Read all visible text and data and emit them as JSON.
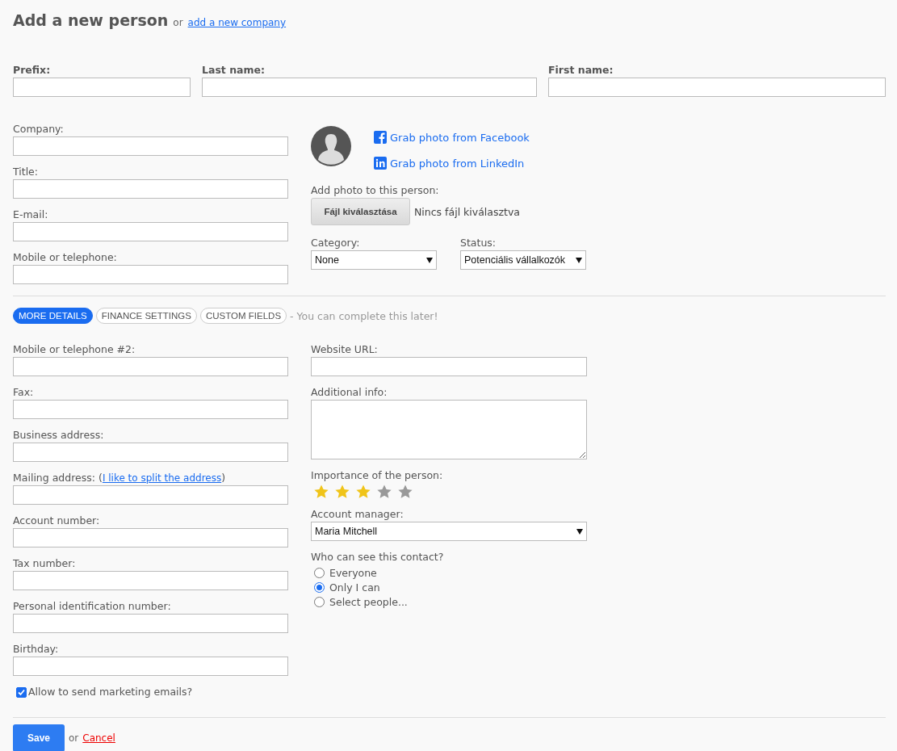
{
  "header": {
    "title": "Add a new person",
    "or_text": "or",
    "company_link": "add a new company"
  },
  "name_fields": [
    {
      "label": "Prefix:"
    },
    {
      "label": "Last name:"
    },
    {
      "label": "First name:"
    }
  ],
  "contact_fields": [
    {
      "label": "Company:"
    },
    {
      "label": "Title:"
    },
    {
      "label": "E-mail:"
    },
    {
      "label": "Mobile or telephone:"
    }
  ],
  "photo": {
    "facebook_link": "Grab photo from Facebook",
    "linkedin_link": "Grab photo from LinkedIn",
    "add_label": "Add photo to this person:",
    "file_button": "Fájl kiválasztása",
    "file_status": "Nincs fájl kiválasztva"
  },
  "category": {
    "label": "Category:",
    "value": "None"
  },
  "status": {
    "label": "Status:",
    "value": "Potenciális vállalkozók"
  },
  "tabs": [
    {
      "label": "MORE DETAILS",
      "selected": true
    },
    {
      "label": "FINANCE SETTINGS",
      "selected": false
    },
    {
      "label": "CUSTOM FIELDS",
      "selected": false
    }
  ],
  "tabs_note": "- You can complete this later!",
  "details_left": [
    {
      "label": "Mobile or telephone #2:"
    },
    {
      "label": "Fax:"
    },
    {
      "label": "Business address:"
    },
    {
      "label": "Mailing address: (",
      "link": "I like to split the address",
      "after": ")"
    },
    {
      "label": "Account number:"
    },
    {
      "label": "Tax number:"
    },
    {
      "label": "Personal identification number:"
    },
    {
      "label": "Birthday:"
    }
  ],
  "website": {
    "label": "Website URL:"
  },
  "additional_info": {
    "label": "Additional info:"
  },
  "importance": {
    "label": "Importance of the person:",
    "stars": 3
  },
  "account_manager": {
    "label": "Account manager:",
    "value": "Maria Mitchell"
  },
  "visibility": {
    "label": "Who can see this contact?",
    "options": [
      {
        "label": "Everyone",
        "selected": false
      },
      {
        "label": "Only I can",
        "selected": true
      },
      {
        "label": "Select people...",
        "selected": false
      }
    ]
  },
  "marketing": {
    "label": "Allow to send marketing emails?",
    "checked": true
  },
  "footer": {
    "save": "Save",
    "or_text": "or",
    "cancel": "Cancel"
  }
}
